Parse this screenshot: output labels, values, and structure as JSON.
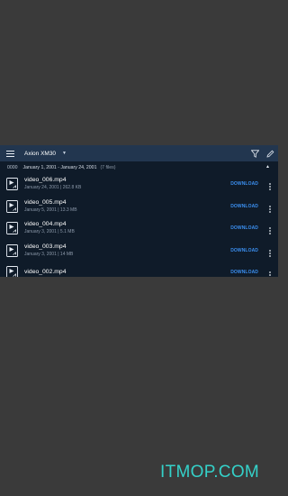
{
  "toolbar": {
    "device_name": "Axion XM30",
    "menu_icon": "hamburger-menu-icon",
    "dropdown_icon": "caret-down-icon",
    "filter_icon": "filter-icon",
    "edit_icon": "pencil-icon"
  },
  "group": {
    "id": "0000",
    "date_range": "January 1, 2001 - January 24, 2001",
    "count": "(7 files)",
    "collapse_icon": "caret-up-icon"
  },
  "files": [
    {
      "name": "video_006.mp4",
      "meta": "January 24, 2001 | 262.8 KB",
      "action": "DOWNLOAD"
    },
    {
      "name": "video_005.mp4",
      "meta": "January 5, 2001 | 13.3 MB",
      "action": "DOWNLOAD"
    },
    {
      "name": "video_004.mp4",
      "meta": "January 3, 2001 | 5.1 MB",
      "action": "DOWNLOAD"
    },
    {
      "name": "video_003.mp4",
      "meta": "January 3, 2001 | 14 MB",
      "action": "DOWNLOAD"
    },
    {
      "name": "video_002.mp4",
      "meta": "",
      "action": "DOWNLOAD"
    }
  ],
  "watermark": "ITMOP.COM",
  "colors": {
    "accent": "#3b8ff0",
    "toolbar_bg": "#22364f",
    "list_bg": "#0f1b29",
    "watermark": "#34d1c9"
  }
}
